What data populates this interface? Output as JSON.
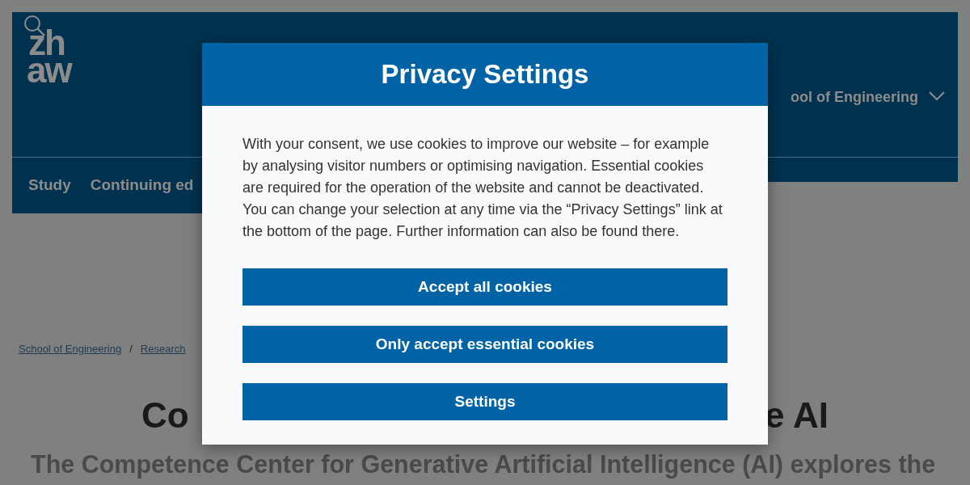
{
  "header": {
    "logo": [
      "zh",
      "aw"
    ],
    "school_menu": "ool of Engineering",
    "nav": [
      "Study",
      "Continuing ed"
    ]
  },
  "breadcrumb": [
    "School of Engineering",
    "Research"
  ],
  "breadcrumb_separator": "/",
  "title_parts": [
    "Co",
    "e AI"
  ],
  "intro": "The Competence Center for Generative Artificial Intelligence (AI) explores the",
  "dialog": {
    "title": "Privacy Settings",
    "text": "With your consent, we use cookies to improve our website – for example by analysing visitor numbers or optimising navigation. Essential cookies are required for the operation of the website and cannot be deactivated. You can change your selection at any time via the “Privacy Settings” link at the bottom of the page. Further information can also be found there.",
    "buttons": [
      "Accept all cookies",
      "Only accept essential cookies",
      "Settings"
    ]
  }
}
